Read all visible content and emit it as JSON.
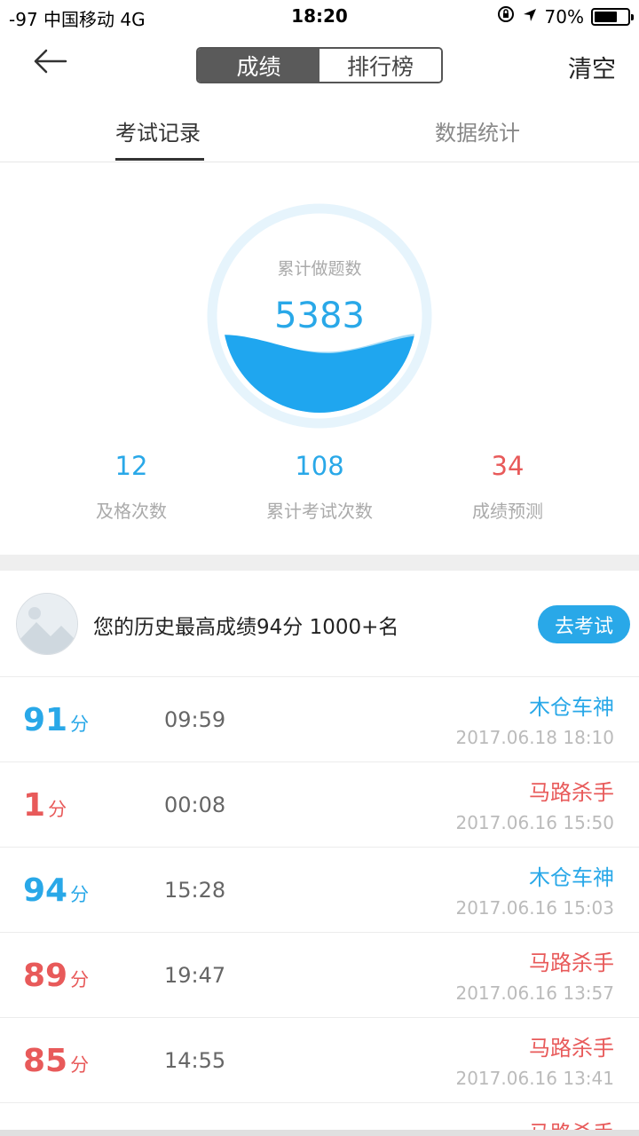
{
  "status_bar": {
    "carrier": "-97 中国移动   4G",
    "time": "18:20",
    "battery": "70%",
    "battery_level": 0.7
  },
  "navbar": {
    "back_icon": "arrow-left-icon",
    "segments": [
      "成绩",
      "排行榜"
    ],
    "active_segment": 0,
    "clear_label": "清空"
  },
  "tabs": {
    "items": [
      "考试记录",
      "数据统计"
    ],
    "active": 0
  },
  "summary": {
    "circle_caption": "累计做题数",
    "total_questions": "5383",
    "stats": [
      {
        "value": "12",
        "label": "及格次数",
        "color": "#29a8e8"
      },
      {
        "value": "108",
        "label": "累计考试次数",
        "color": "#29a8e8"
      },
      {
        "value": "34",
        "label": "成绩预测",
        "color": "#e85a5a"
      }
    ]
  },
  "best": {
    "text": "您的历史最高成绩94分 1000+名",
    "button_label": "去考试"
  },
  "records": [
    {
      "score": "91",
      "unit": "分",
      "duration": "09:59",
      "title": "木仓车神",
      "date": "2017.06.18 18:10",
      "color": "blue"
    },
    {
      "score": "1",
      "unit": "分",
      "duration": "00:08",
      "title": "马路杀手",
      "date": "2017.06.16 15:50",
      "color": "red"
    },
    {
      "score": "94",
      "unit": "分",
      "duration": "15:28",
      "title": "木仓车神",
      "date": "2017.06.16 15:03",
      "color": "blue"
    },
    {
      "score": "89",
      "unit": "分",
      "duration": "19:47",
      "title": "马路杀手",
      "date": "2017.06.16 13:57",
      "color": "red"
    },
    {
      "score": "85",
      "unit": "分",
      "duration": "14:55",
      "title": "马路杀手",
      "date": "2017.06.16 13:41",
      "color": "red"
    },
    {
      "score": "",
      "unit": "",
      "duration": "",
      "title": "马路杀手",
      "date": "",
      "color": "red"
    }
  ],
  "colors": {
    "accent": "#29a8e8",
    "danger": "#e85a5a"
  }
}
